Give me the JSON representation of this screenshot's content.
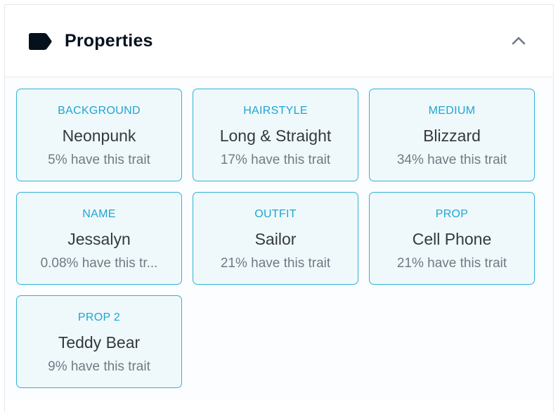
{
  "header": {
    "title": "Properties",
    "icon": "tag-icon",
    "toggle_icon": "chevron-up-icon"
  },
  "colors": {
    "accent": "#2fb3d6",
    "card_background": "#eff9fc",
    "title_text": "#04111d",
    "value_text": "#353840",
    "secondary_text": "#707a83"
  },
  "properties": [
    {
      "type": "BACKGROUND",
      "value": "Neonpunk",
      "rarity": "5% have this trait"
    },
    {
      "type": "HAIRSTYLE",
      "value": "Long & Straight",
      "rarity": "17% have this trait"
    },
    {
      "type": "MEDIUM",
      "value": "Blizzard",
      "rarity": "34% have this trait"
    },
    {
      "type": "NAME",
      "value": "Jessalyn",
      "rarity": "0.08% have this tr..."
    },
    {
      "type": "OUTFIT",
      "value": "Sailor",
      "rarity": "21% have this trait"
    },
    {
      "type": "PROP",
      "value": "Cell Phone",
      "rarity": "21% have this trait"
    },
    {
      "type": "PROP 2",
      "value": "Teddy Bear",
      "rarity": "9% have this trait"
    }
  ]
}
